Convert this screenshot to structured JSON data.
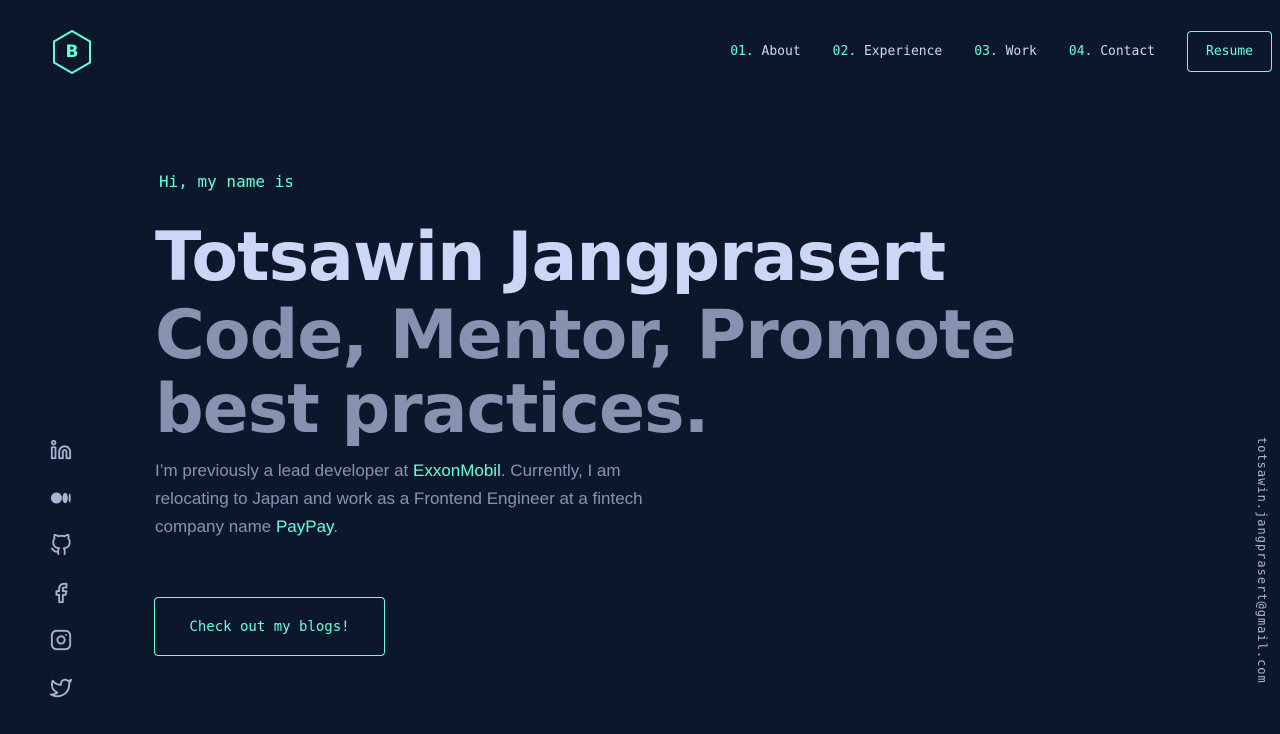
{
  "brand": {
    "letter": "B"
  },
  "nav": {
    "items": [
      {
        "num": "01.",
        "label": "About"
      },
      {
        "num": "02.",
        "label": "Experience"
      },
      {
        "num": "03.",
        "label": "Work"
      },
      {
        "num": "04.",
        "label": "Contact"
      }
    ],
    "resume_label": "Resume"
  },
  "hero": {
    "greeting": "Hi, my name is",
    "name": "Totsawin Jangprasert",
    "tagline": "Code, Mentor, Promote best practices.",
    "intro": {
      "part1": "I’m previously a lead developer at ",
      "company1": "ExxonMobil",
      "part2": ". Currently, I am relocating to Japan and work as a Frontend Engineer at a fintech company name ",
      "company2": "PayPay",
      "part3": "."
    },
    "cta_label": "Check out my blogs!"
  },
  "socials": [
    "linkedin-icon",
    "medium-icon",
    "github-icon",
    "facebook-icon",
    "instagram-icon",
    "twitter-icon"
  ],
  "email": "totsawin.jangprasert@gmail.com",
  "colors": {
    "background": "#0d172c",
    "accent": "#64ffda",
    "heading": "#ccd6f6",
    "text": "#8892b0"
  }
}
